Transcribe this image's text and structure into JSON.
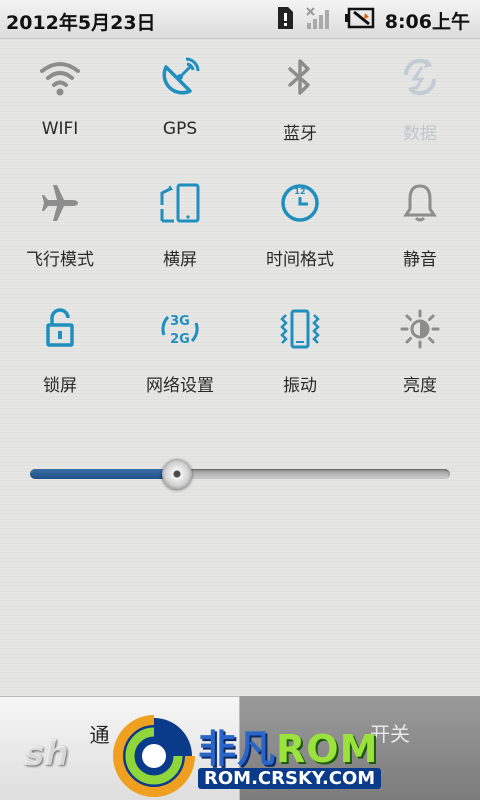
{
  "status_bar": {
    "date": "2012年5月23日",
    "time": "8:06",
    "ampm": "上午",
    "icons": [
      "sd-card-icon",
      "no-signal-icon",
      "battery-charging-icon"
    ]
  },
  "toggles": [
    {
      "label": "WIFI",
      "icon": "wifi-icon",
      "state": "off"
    },
    {
      "label": "GPS",
      "icon": "gps-icon",
      "state": "on"
    },
    {
      "label": "蓝牙",
      "icon": "bluetooth-icon",
      "state": "off"
    },
    {
      "label": "数据",
      "icon": "mobile-data-icon",
      "state": "disabled"
    },
    {
      "label": "飞行模式",
      "icon": "airplane-icon",
      "state": "off"
    },
    {
      "label": "横屏",
      "icon": "rotation-icon",
      "state": "on"
    },
    {
      "label": "时间格式",
      "icon": "clock-icon",
      "state": "on"
    },
    {
      "label": "静音",
      "icon": "bell-icon",
      "state": "off"
    },
    {
      "label": "锁屏",
      "icon": "lock-icon",
      "state": "on"
    },
    {
      "label": "网络设置",
      "icon": "network-3g-2g-icon",
      "state": "on"
    },
    {
      "label": "振动",
      "icon": "vibrate-icon",
      "state": "on"
    },
    {
      "label": "亮度",
      "icon": "brightness-icon",
      "state": "off"
    }
  ],
  "brightness": {
    "level": 0.33
  },
  "tabs": [
    {
      "label": "通"
    },
    {
      "label": "开关"
    }
  ],
  "watermark": {
    "sh": "sh",
    "title_a": "非凡",
    "title_b": "ROM",
    "url": "ROM.CRSKY.COM"
  },
  "colors": {
    "accent_on": "#1f8fc0",
    "icon_off": "#8a8a8a",
    "icon_disabled": "#c3ccd6",
    "slider_fill": "#2c5f97"
  }
}
